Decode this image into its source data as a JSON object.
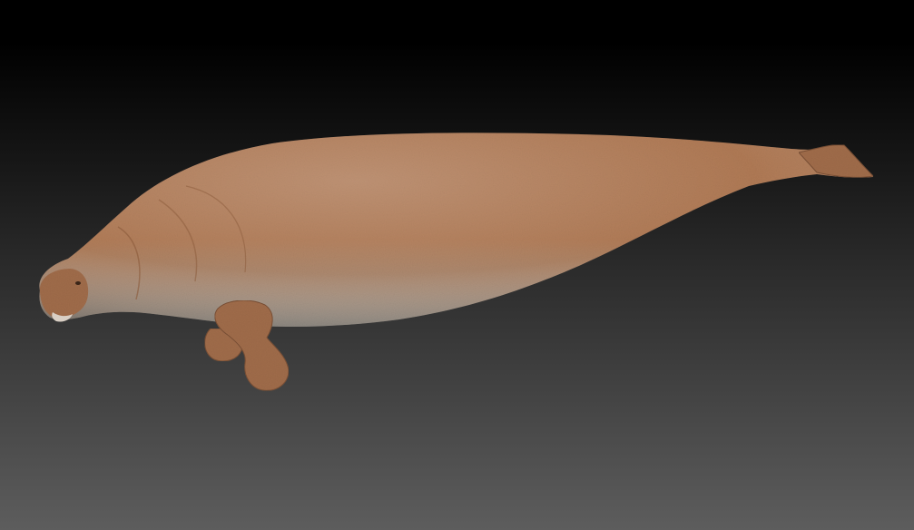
{
  "scene": {
    "background": {
      "top_color": "#000000",
      "bottom_color": "#5d5d5d"
    },
    "subject": {
      "kind": "sirenian-3d-model",
      "skin_color": "#b07a55",
      "skin_shadow_color": "#7a4f34",
      "belly_color": "#a7a097",
      "flipper_color": "#a06c4a"
    }
  }
}
